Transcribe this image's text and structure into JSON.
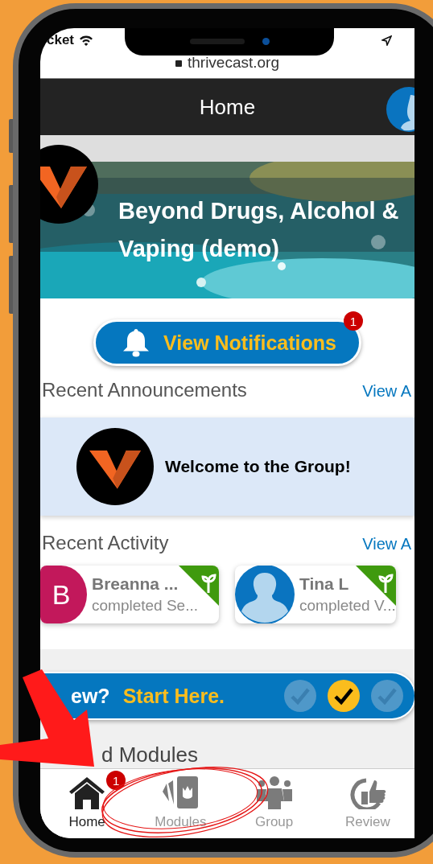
{
  "status_bar": {
    "carrier": "cket"
  },
  "browser": {
    "url": "thrivecast.org"
  },
  "header": {
    "title": "Home"
  },
  "banner": {
    "title": "Beyond Drugs, Alcohol & Vaping (demo)"
  },
  "notifications_button": {
    "label": "View Notifications",
    "badge": "1"
  },
  "announcements": {
    "heading": "Recent Announcements",
    "link": "View A",
    "items": [
      {
        "text": "Welcome to the Group!"
      }
    ]
  },
  "activity": {
    "heading": "Recent Activity",
    "link": "View A",
    "items": [
      {
        "kind": "initial",
        "initial": "B",
        "name": "Breanna ...",
        "detail": "completed Se..."
      },
      {
        "name": "Tina L",
        "detail": "completed V..."
      }
    ]
  },
  "start_bar": {
    "question": "ew?",
    "action": "Start Here.",
    "steps": [
      {
        "selected": false
      },
      {
        "selected": true
      },
      {
        "selected": false
      }
    ]
  },
  "section_heading": "d Modules",
  "tabs": [
    {
      "kind": "house",
      "label": "Home",
      "selected": true,
      "badge": "1"
    },
    {
      "kind": "cards",
      "label": "Modules",
      "selected": false
    },
    {
      "kind": "people",
      "label": "Group",
      "selected": false
    },
    {
      "kind": "thumbs-up",
      "label": "Review",
      "selected": false
    }
  ]
}
